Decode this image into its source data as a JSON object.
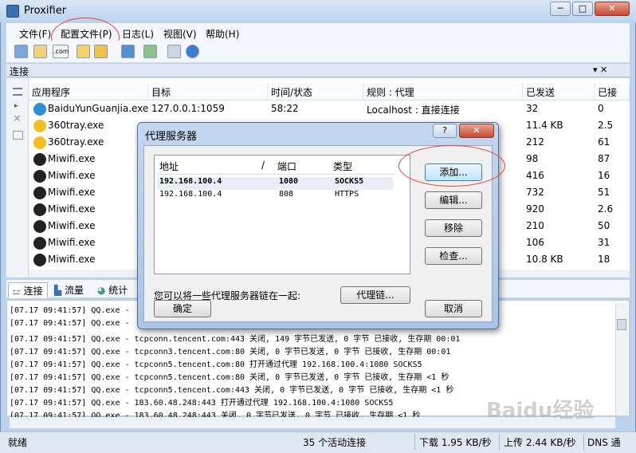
{
  "window": {
    "title": "Proxifier",
    "min": "─",
    "max": "□",
    "close": "✕"
  },
  "menu": [
    "文件(F)",
    "配置文件(P)",
    "日志(L)",
    "视图(V)",
    "帮助(H)"
  ],
  "toolbar_icons": [
    "connect-icon",
    "profile-icon",
    "dns-icon",
    "rules-icon",
    "open-icon",
    "save-icon",
    "export-icon",
    "print-icon",
    "help-icon"
  ],
  "section": {
    "title": "连接",
    "pin": "▾ ✕"
  },
  "columns": [
    "应用程序",
    "目标",
    "时间/状态",
    "规则 : 代理",
    "已发送",
    "已接"
  ],
  "rows": [
    {
      "app": "BaiduYunGuanjia.exe",
      "icon": "cloud-icon",
      "target": "127.0.0.1:1059",
      "time": "58:22",
      "rule": "Localhost : 直接连接",
      "sent": "32",
      "recv": "0"
    },
    {
      "app": "360tray.exe",
      "icon": "shield-icon",
      "target": "",
      "time": "",
      "rule": "",
      "sent": "11.4 KB",
      "recv": "2.5"
    },
    {
      "app": "360tray.exe",
      "icon": "shield-icon",
      "target": "",
      "time": "",
      "rule": "",
      "sent": "212",
      "recv": "61"
    },
    {
      "app": "Miwifi.exe",
      "icon": "wifi-icon",
      "target": "",
      "time": "",
      "rule": "",
      "sent": "98",
      "recv": "87"
    },
    {
      "app": "Miwifi.exe",
      "icon": "wifi-icon",
      "target": "",
      "time": "",
      "rule": "",
      "sent": "416",
      "recv": "16"
    },
    {
      "app": "Miwifi.exe",
      "icon": "wifi-icon",
      "target": "",
      "time": "",
      "rule": "",
      "sent": "732",
      "recv": "51"
    },
    {
      "app": "Miwifi.exe",
      "icon": "wifi-icon",
      "target": "",
      "time": "",
      "rule": "",
      "sent": "920",
      "recv": "2.6"
    },
    {
      "app": "Miwifi.exe",
      "icon": "wifi-icon",
      "target": "",
      "time": "",
      "rule": "",
      "sent": "210",
      "recv": "50"
    },
    {
      "app": "Miwifi.exe",
      "icon": "wifi-icon",
      "target": "",
      "time": "",
      "rule": "",
      "sent": "106",
      "recv": "31"
    },
    {
      "app": "Miwifi.exe",
      "icon": "wifi-icon",
      "target": "",
      "time": "",
      "rule": "",
      "sent": "10.8 KB",
      "recv": "18"
    }
  ],
  "tabs": [
    "连接",
    "流量",
    "统计"
  ],
  "log": [
    "[07.17 09:41:57] QQ.exe -",
    "[07.17 09:41:57] QQ.exe -",
    "[07.17 09:41:57] QQ.exe - tcpconn.tencent.com:443 关闭, 149 字节已发送, 0 字节 已接收, 生存期 00:01",
    "[07.17 09:41:57] QQ.exe - tcpconn3.tencent.com:80 关闭, 0 字节已发送, 0 字节 已接收, 生存期 00:01",
    "[07.17 09:41:57] QQ.exe - tcpconn5.tencent.com:80 打开通过代理 192.168.100.4:1080 SOCKS5",
    "[07.17 09:41:57] QQ.exe - tcpconn5.tencent.com:80 关闭, 0 字节已发送, 0 字节 已接收, 生存期 <1 秒",
    "[07.17 09:41:57] QQ.exe - tcpconn5.tencent.com:443 关闭, 0 字节已发送, 0 字节 已接收, 生存期 <1 秒",
    "[07.17 09:41:57] QQ.exe - 183.60.48.248:443 打开通过代理 192.168.100.4:1080 SOCKS5",
    "[07.17 09:41:57] QQ.exe - 183.60.48.248:443 关闭, 0 字节已发送, 0 字节 已接收, 生存期 <1 秒"
  ],
  "status": {
    "ready": "就绪",
    "active": "35 个活动连接",
    "download": "下载 1.95 KB/秒",
    "upload": "上传 2.44 KB/秒",
    "dns": "DNS 通"
  },
  "dialog": {
    "title": "代理服务器",
    "help": "?",
    "close": "✕",
    "list_headers": [
      "地址",
      "/",
      "端口",
      "类型"
    ],
    "list_rows": [
      {
        "addr": "192.168.100.4",
        "port": "1080",
        "type": "SOCKS5"
      },
      {
        "addr": "192.168.100.4",
        "port": "808",
        "type": "HTTPS"
      }
    ],
    "buttons": {
      "add": "添加...",
      "edit": "编辑...",
      "remove": "移除",
      "check": "检查...",
      "chain": "代理链...",
      "ok": "确定",
      "cancel": "取消"
    },
    "note": "您可以将一些代理服务器链在一起:"
  },
  "watermark": "Baidu经验"
}
